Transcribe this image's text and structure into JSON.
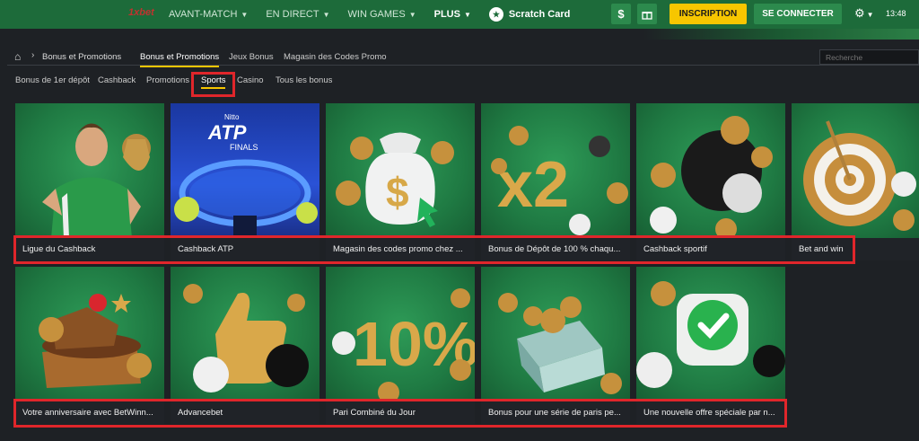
{
  "header": {
    "logo_text": "1xbet",
    "nav": [
      {
        "label": "AVANT-MATCH",
        "chevron": true
      },
      {
        "label": "EN DIRECT",
        "chevron": true
      },
      {
        "label": "WIN GAMES",
        "chevron": true
      },
      {
        "label": "PLUS",
        "chevron": true
      }
    ],
    "scratch_label": "Scratch Card",
    "dollar_icon": "$",
    "gift_icon": "gift-icon",
    "inscription_label": "INSCRIPTION",
    "connect_label": "SE CONNECTER",
    "time": "13:48",
    "colors": {
      "header_bg": "#1d6b3a",
      "accent": "#f7c600",
      "green_button": "#2c8a4d"
    }
  },
  "subnav": {
    "breadcrumb": "Bonus et Promotions",
    "tabs": [
      "Bonus et Promotions",
      "Jeux Bonus",
      "Magasin des Codes Promo"
    ],
    "active_tab": "Bonus et Promotions",
    "search_placeholder": "Recherche"
  },
  "categories": {
    "items": [
      "Bonus de 1er dépôt",
      "Cashback",
      "Promotions",
      "Sports",
      "Casino",
      "Tous les bonus"
    ],
    "active": "Sports"
  },
  "cards_row1": [
    {
      "title": "Ligue du Cashback"
    },
    {
      "title": "Cashback ATP"
    },
    {
      "title": "Magasin des codes promo chez ..."
    },
    {
      "title": "Bonus de Dépôt de 100 % chaqu..."
    },
    {
      "title": "Cashback sportif"
    },
    {
      "title": "Bet and win"
    }
  ],
  "cards_row2": [
    {
      "title": "Votre anniversaire avec BetWinn..."
    },
    {
      "title": "Advancebet"
    },
    {
      "title": "Pari Combiné du Jour"
    },
    {
      "title": "Bonus pour une série de paris pe..."
    },
    {
      "title": "Une nouvelle offre spéciale par n..."
    }
  ],
  "art_text": {
    "atp_brand": "Nitto",
    "atp_logo": "ATP",
    "atp_sub": "FINALS",
    "x2": "x2",
    "ten_percent": "10%",
    "coin_symbol": "$"
  }
}
